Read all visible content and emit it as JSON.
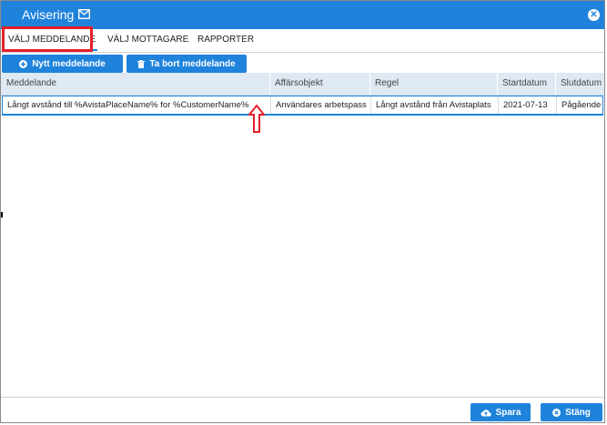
{
  "window": {
    "title": "Avisering"
  },
  "tabs": [
    {
      "label": "VÄLJ MEDDELANDE"
    },
    {
      "label": "VÄLJ MOTTAGARE"
    },
    {
      "label": "RAPPORTER"
    }
  ],
  "toolbar": {
    "new_label": "Nytt meddelande",
    "delete_label": "Ta bort meddelande"
  },
  "table": {
    "columns": [
      "Meddelande",
      "Affärsobjekt",
      "Regel",
      "Startdatum",
      "Slutdatum"
    ],
    "rows": [
      [
        "Långt avstånd till %AvistaPlaceName% for %CustomerName%",
        "Användares arbetspass",
        "Långt avstånd från Avistaplats",
        "2021-07-13",
        "Pågående"
      ]
    ]
  },
  "footer": {
    "save_label": "Spara",
    "close_label": "Stäng"
  },
  "colors": {
    "accent": "#1f83dc",
    "highlight": "#e3202a"
  }
}
